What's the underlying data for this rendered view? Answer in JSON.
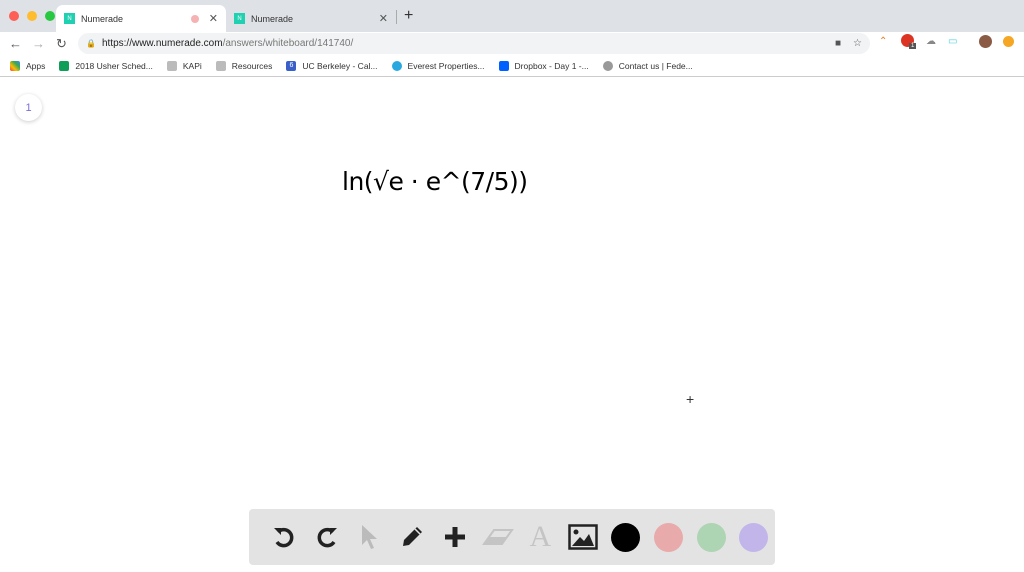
{
  "browser": {
    "tabs": [
      {
        "title": "Numerade",
        "active": true,
        "recording": true
      },
      {
        "title": "Numerade",
        "active": false
      }
    ],
    "url_host": "https://www.numerade.com",
    "url_path": "/answers/whiteboard/141740/",
    "bookmarks": [
      {
        "label": "Apps",
        "icon": "apps-grid-icon"
      },
      {
        "label": "2018 Usher Sched...",
        "icon": "sheets-icon"
      },
      {
        "label": "KAPi",
        "icon": "folder-icon"
      },
      {
        "label": "Resources",
        "icon": "folder-icon"
      },
      {
        "label": "UC Berkeley - Cal...",
        "icon": "calendar-icon"
      },
      {
        "label": "Everest Properties...",
        "icon": "refresh-circle-icon"
      },
      {
        "label": "Dropbox - Day 1 -...",
        "icon": "dropbox-icon"
      },
      {
        "label": "Contact us | Fede...",
        "icon": "globe-icon"
      }
    ],
    "extension_badge": "1"
  },
  "whiteboard": {
    "page_number": "1",
    "handwriting": "ln(√e · e^(7/5))",
    "colors": {
      "black": "#000000",
      "red": "#e8aaaa",
      "green": "#add4b3",
      "purple": "#c1b5ea"
    }
  }
}
